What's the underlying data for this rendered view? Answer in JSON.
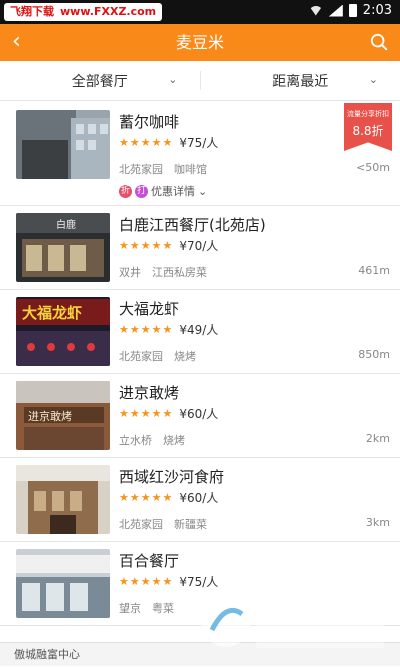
{
  "status_bar": {
    "watermark_brand": "飞翔下载",
    "watermark_url": "www.FXXZ.com",
    "time": "2:03"
  },
  "header": {
    "title": "麦豆米"
  },
  "filters": [
    {
      "label": "全部餐厅"
    },
    {
      "label": "距离最近"
    }
  ],
  "restaurants": [
    {
      "name": "蓄尔咖啡",
      "rating": 5,
      "price": "¥75/人",
      "area": "北苑家园",
      "category": "咖啡馆",
      "distance": "<50m",
      "badge": {
        "line1": "流量分享折扣",
        "line2": "8.8折"
      },
      "promo_icons": [
        "折",
        "打"
      ],
      "promo_text": "优惠详情"
    },
    {
      "name": "白鹿江西餐厅(北苑店)",
      "rating": 5,
      "price": "¥70/人",
      "area": "双井",
      "category": "江西私房菜",
      "distance": "461m"
    },
    {
      "name": "大福龙虾",
      "rating": 5,
      "price": "¥49/人",
      "area": "北苑家园",
      "category": "烧烤",
      "distance": "850m"
    },
    {
      "name": "进京敢烤",
      "rating": 5,
      "price": "¥60/人",
      "area": "立水桥",
      "category": "烧烤",
      "distance": "2km"
    },
    {
      "name": "西域红沙河食府",
      "rating": 5,
      "price": "¥60/人",
      "area": "北苑家园",
      "category": "新疆菜",
      "distance": "3km"
    },
    {
      "name": "百合餐厅",
      "rating": 5,
      "price": "¥75/人",
      "area": "望京",
      "category": "粤菜",
      "distance": ""
    }
  ],
  "bottom": {
    "text": "傲城融富中心"
  },
  "colors": {
    "accent": "#f98a1a",
    "star": "#f7941d",
    "badge": "#e8504a"
  },
  "icons": {
    "back": "chevron-left-icon",
    "search": "search-icon",
    "dropdown": "chevron-down-icon"
  }
}
